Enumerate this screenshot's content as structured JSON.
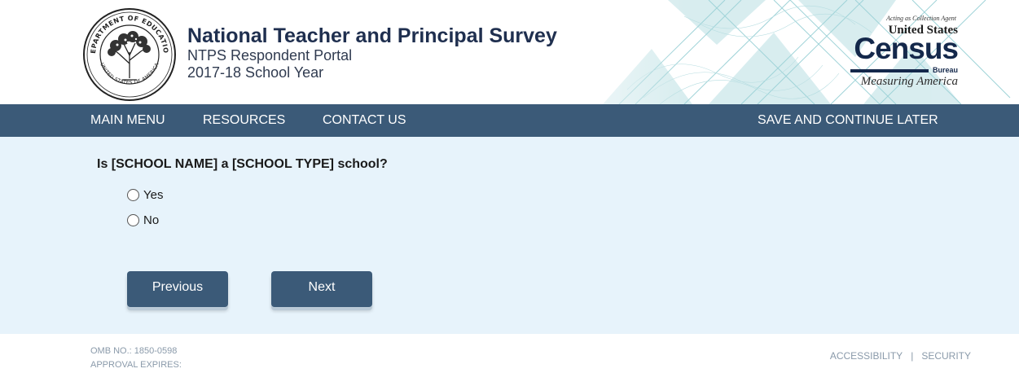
{
  "header": {
    "title": "National Teacher and Principal Survey",
    "subtitle": "NTPS Respondent Portal",
    "school_year": "2017-18 School Year",
    "seal_icon": "department-of-education-seal-icon",
    "seal_text_top": "DEPARTMENT OF EDUCATION",
    "seal_text_bottom": "UNITED STATES OF AMERICA",
    "census": {
      "acting": "Acting as Collection Agent",
      "united_states": "United States",
      "census": "Census",
      "bureau": "Bureau",
      "measuring": "Measuring America"
    }
  },
  "nav": {
    "main_menu": "MAIN MENU",
    "resources": "RESOURCES",
    "contact_us": "CONTACT US",
    "save_later": "SAVE AND CONTINUE LATER"
  },
  "question": {
    "text": "Is [SCHOOL NAME] a [SCHOOL TYPE] school?",
    "options": [
      {
        "label": "Yes",
        "selected": false
      },
      {
        "label": "No",
        "selected": false
      }
    ]
  },
  "buttons": {
    "previous": "Previous",
    "next": "Next"
  },
  "footer": {
    "omb": "OMB NO.: 1850-0598",
    "approval": "APPROVAL EXPIRES:",
    "accessibility": "ACCESSIBILITY",
    "separator": "|",
    "security": "SECURITY"
  },
  "colors": {
    "nav_bar": "#3b5a78",
    "content_bg": "#e7f3fb",
    "title": "#1f2f4f",
    "button": "#3b5a78",
    "footer_text": "#8a9aaa"
  }
}
